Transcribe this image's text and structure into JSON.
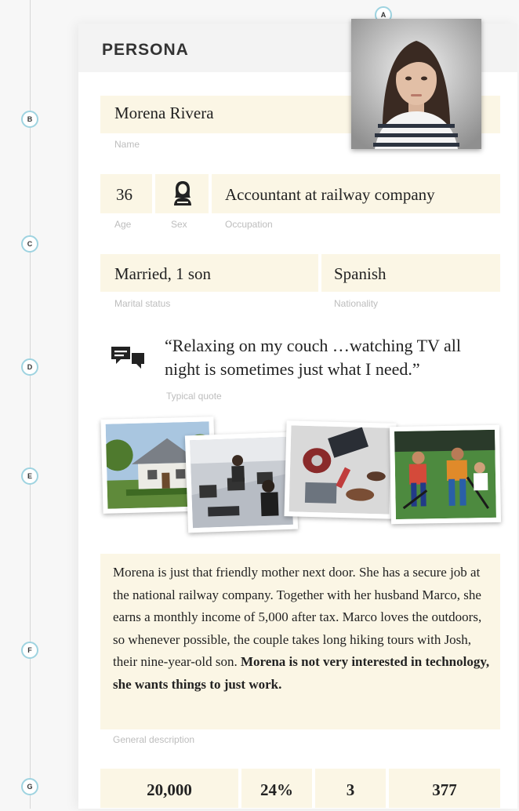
{
  "header": {
    "title": "PERSONA"
  },
  "markers": [
    "A",
    "B",
    "C",
    "D",
    "E",
    "F",
    "G"
  ],
  "persona": {
    "name": "Morena Rivera",
    "age": "36",
    "occupation": "Accountant at railway company",
    "marital_status": "Married, 1 son",
    "nationality": "Spanish",
    "quote_line1": "“Relaxing on my couch …watching TV all",
    "quote_line2": "night is sometimes just what I need.”",
    "description_plain": "Morena is just that friendly mother next door. She has a secure job at the national railway company. Together with her husband Marco, she earns a monthly income of 5,000 after tax. Marco loves the outdoors, so whenever possible, the couple takes long hiking tours with Josh, their nine-year-old son.",
    "description_bold": "Morena is not very interested in technology, she wants things to just work."
  },
  "labels": {
    "name": "Name",
    "age": "Age",
    "sex": "Sex",
    "occupation": "Occupation",
    "marital_status": "Marital status",
    "nationality": "Nationality",
    "quote": "Typical quote",
    "description": "General description"
  },
  "icons": {
    "sex": "female-user-icon",
    "quote": "speech-bubbles-icon"
  },
  "photos": [
    "house-photo",
    "office-photo",
    "lifestyle-photo",
    "field-hockey-photo"
  ],
  "stats": [
    "20,000",
    "24%",
    "3",
    "377"
  ],
  "colors": {
    "field_bg": "#fbf6e5",
    "marker_ring": "#9ed3e0"
  }
}
